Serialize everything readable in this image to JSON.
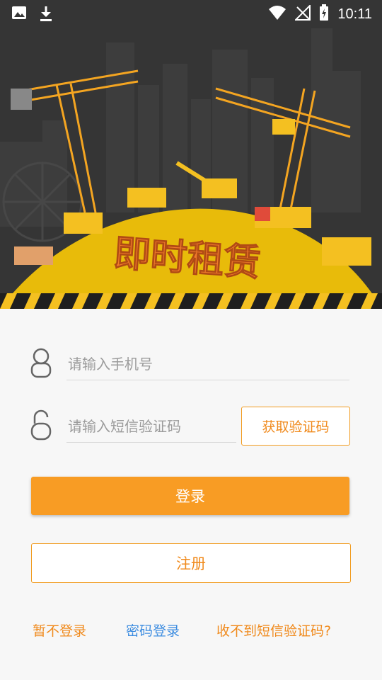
{
  "status_bar": {
    "time": "10:11"
  },
  "hero": {
    "title": "即时租赁"
  },
  "form": {
    "phone_placeholder": "请输入手机号",
    "code_placeholder": "请输入短信验证码",
    "get_code_label": "获取验证码",
    "login_label": "登录",
    "register_label": "注册"
  },
  "footer_links": {
    "skip_login": "暂不登录",
    "password_login": "密码登录",
    "no_code": "收不到短信验证码?"
  },
  "colors": {
    "accent": "#f89c24",
    "link_blue": "#3c8ce0",
    "hero_bg": "#353535"
  }
}
